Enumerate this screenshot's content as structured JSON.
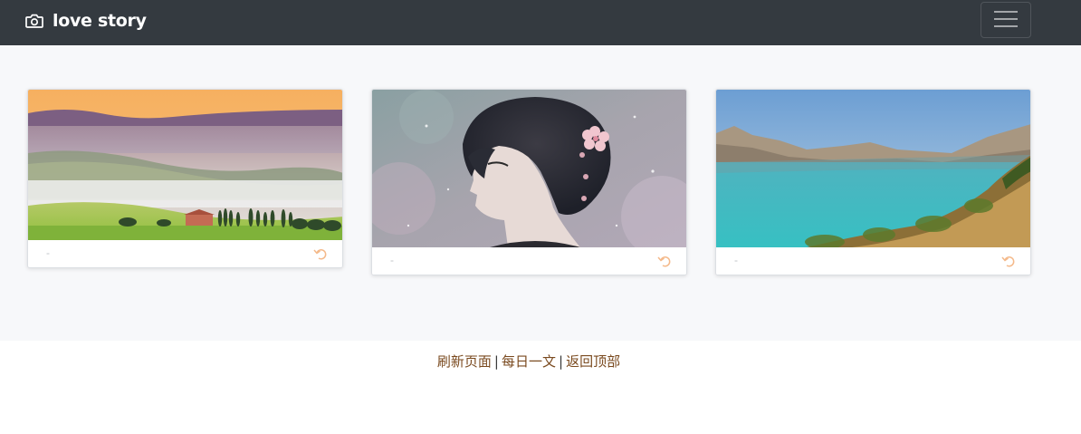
{
  "navbar": {
    "brand_icon": "camera-icon",
    "brand_text": "love story",
    "toggler_icon": "hamburger-menu-icon"
  },
  "cards": [
    {
      "image": "tuscany-misty-hills-landscape",
      "meta": "-",
      "action_icon": "undo-arrow-icon"
    },
    {
      "image": "anime-girl-profile-with-flower-hairpin",
      "meta": "-",
      "action_icon": "undo-arrow-icon"
    },
    {
      "image": "mountain-lake-turquoise-water",
      "meta": "-",
      "action_icon": "undo-arrow-icon"
    }
  ],
  "footer": {
    "links": [
      "刷新页面",
      "每日一文",
      "返回顶部"
    ],
    "separator": "|"
  },
  "colors": {
    "navbar_bg": "#343a40",
    "main_bg": "#f7f8fa",
    "footer_link": "#7a4a1f",
    "action_icon": "#f4b98a"
  }
}
